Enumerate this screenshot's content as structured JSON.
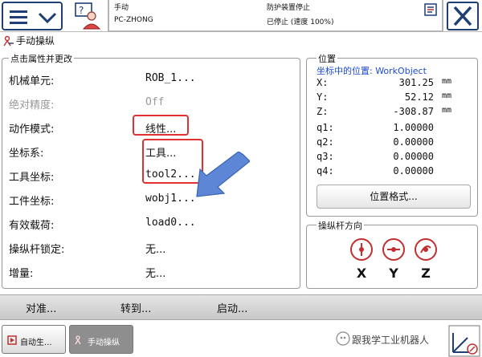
{
  "status": {
    "mode": "手动",
    "system_name": "PC-ZHONG",
    "guard": "防护装置停止",
    "state": "已停止 (速度 100%)"
  },
  "page": {
    "title": "手动操纵"
  },
  "properties": {
    "legend": "点击属性并更改",
    "rows": [
      {
        "label": "机械单元:",
        "value": "ROB_1...",
        "disabled": false
      },
      {
        "label": "绝对精度:",
        "value": "Off",
        "disabled": true
      },
      {
        "label": "动作模式:",
        "value": "线性...",
        "disabled": false
      },
      {
        "label": "坐标系:",
        "value": "工具...",
        "disabled": false
      },
      {
        "label": "工具坐标:",
        "value": "tool2...",
        "disabled": false
      },
      {
        "label": "工件坐标:",
        "value": "wobj1...",
        "disabled": false
      },
      {
        "label": "有效载荷:",
        "value": "load0...",
        "disabled": false
      },
      {
        "label": "操纵杆锁定:",
        "value": "无...",
        "disabled": false
      },
      {
        "label": "增量:",
        "value": "无...",
        "disabled": false
      }
    ]
  },
  "position": {
    "legend": "位置",
    "subtitle": "坐标中的位置: WorkObject",
    "rows": [
      {
        "name": "X:",
        "value": "301.25",
        "unit": "mm"
      },
      {
        "name": "Y:",
        "value": "52.12",
        "unit": "mm"
      },
      {
        "name": "Z:",
        "value": "-308.87",
        "unit": "mm"
      },
      {
        "name": "q1:",
        "value": "1.00000",
        "unit": ""
      },
      {
        "name": "q2:",
        "value": "0.00000",
        "unit": ""
      },
      {
        "name": "q3:",
        "value": "0.00000",
        "unit": ""
      },
      {
        "name": "q4:",
        "value": "0.00000",
        "unit": ""
      }
    ],
    "format_button": "位置格式..."
  },
  "jog": {
    "legend": "操纵杆方向",
    "axes": [
      "X",
      "Y",
      "Z"
    ]
  },
  "commands": {
    "align": "对准...",
    "goto": "转到...",
    "start": "启动..."
  },
  "taskbar": {
    "item1": "自动生...",
    "item2": "手动操纵",
    "watermark": "跟我学工业机器人"
  },
  "icons": {
    "menu": "hamburger-menu-icon",
    "user": "user-icon",
    "close": "close-icon",
    "jog": "robot-jog-icon"
  },
  "colors": {
    "accent": "#1f3f74",
    "highlight": "#e03030",
    "arrow": "#5d86d6",
    "link": "#1d4ad0"
  }
}
